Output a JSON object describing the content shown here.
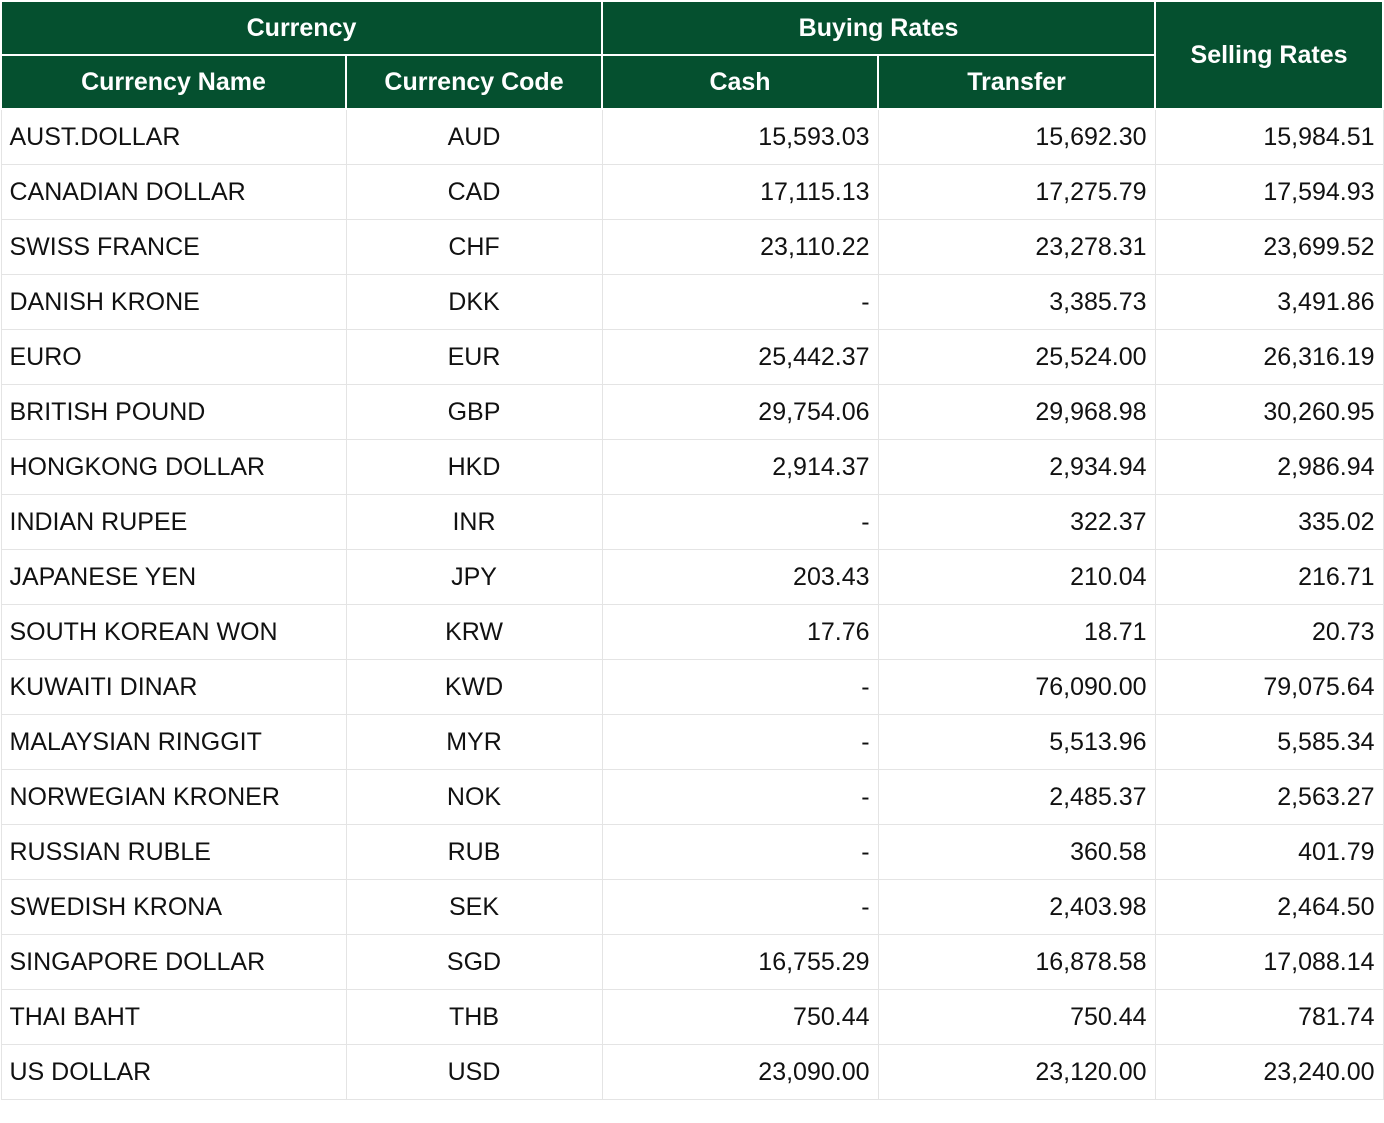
{
  "header": {
    "currency_group": "Currency",
    "buying_group": "Buying Rates",
    "selling": "Selling Rates",
    "currency_name": "Currency Name",
    "currency_code": "Currency Code",
    "cash": "Cash",
    "transfer": "Transfer"
  },
  "colors": {
    "header_bg": "#05502f",
    "header_text": "#ffffff"
  },
  "rows": [
    {
      "name": "AUST.DOLLAR",
      "code": "AUD",
      "cash": "15,593.03",
      "transfer": "15,692.30",
      "selling": "15,984.51"
    },
    {
      "name": "CANADIAN DOLLAR",
      "code": "CAD",
      "cash": "17,115.13",
      "transfer": "17,275.79",
      "selling": "17,594.93"
    },
    {
      "name": "SWISS FRANCE",
      "code": "CHF",
      "cash": "23,110.22",
      "transfer": "23,278.31",
      "selling": "23,699.52"
    },
    {
      "name": "DANISH KRONE",
      "code": "DKK",
      "cash": "-",
      "transfer": "3,385.73",
      "selling": "3,491.86"
    },
    {
      "name": "EURO",
      "code": "EUR",
      "cash": "25,442.37",
      "transfer": "25,524.00",
      "selling": "26,316.19"
    },
    {
      "name": "BRITISH POUND",
      "code": "GBP",
      "cash": "29,754.06",
      "transfer": "29,968.98",
      "selling": "30,260.95"
    },
    {
      "name": "HONGKONG DOLLAR",
      "code": "HKD",
      "cash": "2,914.37",
      "transfer": "2,934.94",
      "selling": "2,986.94"
    },
    {
      "name": "INDIAN RUPEE",
      "code": "INR",
      "cash": "-",
      "transfer": "322.37",
      "selling": "335.02"
    },
    {
      "name": "JAPANESE YEN",
      "code": "JPY",
      "cash": "203.43",
      "transfer": "210.04",
      "selling": "216.71"
    },
    {
      "name": "SOUTH KOREAN WON",
      "code": "KRW",
      "cash": "17.76",
      "transfer": "18.71",
      "selling": "20.73"
    },
    {
      "name": "KUWAITI DINAR",
      "code": "KWD",
      "cash": "-",
      "transfer": "76,090.00",
      "selling": "79,075.64"
    },
    {
      "name": "MALAYSIAN RINGGIT",
      "code": "MYR",
      "cash": "-",
      "transfer": "5,513.96",
      "selling": "5,585.34"
    },
    {
      "name": "NORWEGIAN KRONER",
      "code": "NOK",
      "cash": "-",
      "transfer": "2,485.37",
      "selling": "2,563.27"
    },
    {
      "name": "RUSSIAN RUBLE",
      "code": "RUB",
      "cash": "-",
      "transfer": "360.58",
      "selling": "401.79"
    },
    {
      "name": "SWEDISH KRONA",
      "code": "SEK",
      "cash": "-",
      "transfer": "2,403.98",
      "selling": "2,464.50"
    },
    {
      "name": "SINGAPORE DOLLAR",
      "code": "SGD",
      "cash": "16,755.29",
      "transfer": "16,878.58",
      "selling": "17,088.14"
    },
    {
      "name": "THAI BAHT",
      "code": "THB",
      "cash": "750.44",
      "transfer": "750.44",
      "selling": "781.74"
    },
    {
      "name": "US DOLLAR",
      "code": "USD",
      "cash": "23,090.00",
      "transfer": "23,120.00",
      "selling": "23,240.00"
    }
  ]
}
